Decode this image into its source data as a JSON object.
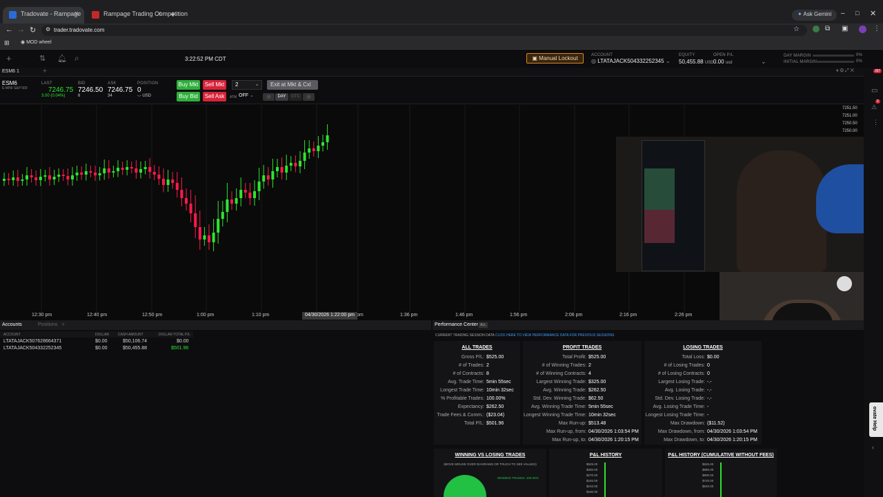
{
  "browser": {
    "tabs": [
      {
        "title": "Tradovate - Rampage",
        "active": true
      },
      {
        "title": "Rampage Trading Competition",
        "active": false
      }
    ],
    "url": "trader.tradovate.com",
    "ask_gemini": "Ask Gemini",
    "bookmark": "MOD wheel"
  },
  "header": {
    "time": "3:22:52 PM CDT",
    "lockout_button": "Manual Lockout",
    "account_label": "ACCOUNT",
    "account_value": "LTATAJACK504332252345",
    "equity_label": "EQUITY",
    "equity_value": "50,455.88",
    "equity_ccy": "USD",
    "openpl_label": "OPEN P/L",
    "openpl_value": "0.00",
    "openpl_ccy": "usd",
    "day_margin_label": "DAY MARGIN",
    "day_margin_pct": "0%",
    "initial_margin_label": "INITIAL MARGIN",
    "initial_margin_pct": "0%"
  },
  "symbol_bar": {
    "tab_label": "ESM6 1",
    "symbol": "ESM6",
    "desc": "E-MINI S&P 500",
    "last_label": "LAST",
    "last_value": "7246.75",
    "last_change": "3.00 (0.04%)",
    "bid_label": "BID",
    "bid_value": "7246.50",
    "bid_size": "6",
    "ask_label": "ASK",
    "ask_value": "7246.75",
    "ask_size": "34",
    "position_label": "POSITION",
    "position_value": "0",
    "position_ccy": "-,- USD"
  },
  "order": {
    "buy_mkt": "Buy Mkt",
    "sell_mkt": "Sell Mkt",
    "buy_bid": "Buy Bid",
    "sell_ask": "Sell Ask",
    "qty": "2",
    "exit": "Exit at Mkt & Cxl",
    "atm_label": "ATM",
    "atm_value": "OFF",
    "day": "DAY",
    "gtc": "GTC"
  },
  "chart_area": {
    "x_ticks": [
      "12:30 pm",
      "12:40 pm",
      "12:50 pm",
      "1:00 pm",
      "1:10 pm",
      "1:36 pm",
      "1:46 pm",
      "1:56 pm",
      "2:06 pm",
      "2:16 pm",
      "2:26 pm"
    ],
    "cursor_label": "04/30/2026 1:22:00 pm",
    "cursor_suffix": "pm",
    "y_ticks": [
      "7251.50",
      "7251.00",
      "7250.50",
      "7250.00"
    ]
  },
  "accounts_panel": {
    "tab_accounts": "Accounts",
    "tab_positions": "Positions",
    "col_account": "ACCOUNT",
    "col_dollar": "DOLLAR",
    "col_cash": "CASH AMOUNT",
    "col_total": "DOLLAR TOTAL P/L",
    "rows": [
      {
        "account": "LTATAJACK507628664371",
        "dollar": "$0.00",
        "cash": "$50,106.74",
        "total": "$0.00"
      },
      {
        "account": "LTATAJACK504332252345",
        "dollar": "$0.00",
        "cash": "$50,455.88",
        "total": "$501.96"
      }
    ]
  },
  "performance": {
    "title": "Performance Center",
    "all_badge": "ALL",
    "session_note": "CURRENT TRADING SESSION DATA",
    "session_link": "CLICK HERE TO VIEW PERFORMANCE DATA FOR PREVIOUS SESSIONS",
    "all_trades": {
      "header": "ALL TRADES",
      "rows": [
        {
          "k": "Gross P/L",
          "v": "$525.00"
        },
        {
          "k": "# of Trades",
          "v": "2"
        },
        {
          "k": "# of Contracts",
          "v": "8"
        },
        {
          "k": "Avg. Trade Time",
          "v": "5min 55sec"
        },
        {
          "k": "Longest Trade Time",
          "v": "10min 32sec"
        },
        {
          "k": "% Profitable Trades",
          "v": "100.00%"
        },
        {
          "k": "Expectancy",
          "v": "$262.50"
        },
        {
          "k": "Trade Fees & Comm.",
          "v": "($23.04)"
        },
        {
          "k": "Total P/L",
          "v": "$501.96"
        }
      ]
    },
    "profit_trades": {
      "header": "PROFIT TRADES",
      "rows": [
        {
          "k": "Total Profit",
          "v": "$525.00"
        },
        {
          "k": "# of Winning Trades",
          "v": "2"
        },
        {
          "k": "# of Winning Contracts",
          "v": "4"
        },
        {
          "k": "Largest Winning Trade",
          "v": "$325.00"
        },
        {
          "k": "Avg. Winning Trade",
          "v": "$262.50"
        },
        {
          "k": "Std. Dev. Winning Trade",
          "v": "$62.50"
        },
        {
          "k": "Avg. Winning Trade Time",
          "v": "5min 55sec"
        },
        {
          "k": "Longest Winning Trade Time",
          "v": "10min 32sec"
        },
        {
          "k": "Max Run-up",
          "v": "$513.48"
        },
        {
          "k": "Max Run-up, from",
          "v": "04/30/2026 1:03:54 PM"
        },
        {
          "k": "Max Run-up, to",
          "v": "04/30/2026 1:20:15 PM"
        }
      ]
    },
    "losing_trades": {
      "header": "LOSING TRADES",
      "rows": [
        {
          "k": "Total Loss",
          "v": "$0.00"
        },
        {
          "k": "# of Losing Trades",
          "v": "0"
        },
        {
          "k": "# of Losing Contracts",
          "v": "0"
        },
        {
          "k": "Largest Losing Trade",
          "v": "-.-"
        },
        {
          "k": "Avg. Losing Trade",
          "v": "-.-"
        },
        {
          "k": "Std. Dev. Losing Trade",
          "v": "-.-"
        },
        {
          "k": "Avg. Losing Trade Time",
          "v": "-"
        },
        {
          "k": "Longest Losing Trade Time",
          "v": "-"
        },
        {
          "k": "Max Drawdown",
          "v": "($11.52)"
        },
        {
          "k": "Max Drawdown, from",
          "v": "04/30/2026 1:03:54 PM"
        },
        {
          "k": "Max Drawdown, to",
          "v": "04/30/2026 1:20:15 PM"
        }
      ]
    },
    "chart_titles": {
      "win_vs_lose": "WINNING VS LOSING TRADES",
      "win_vs_lose_note": "(MOVE MOUSE OVER DIAGRAMS OR TOUCH TO SEE VALUES)",
      "winning_label": "WINNING TRADES: 100.00%",
      "pl_history": "P&L HISTORY",
      "pl_history_cum": "P&L HISTORY (CUMULATIVE WITHOUT FEES)",
      "pl_ticks": [
        "$525.00",
        "$300.00",
        "$270.00",
        "$240.00",
        "$210.00",
        "$180.00"
      ],
      "cum_ticks": [
        "$525.00",
        "$880.00",
        "$800.00",
        "$720.00",
        "$640.00"
      ]
    }
  },
  "side": {
    "badge1": "367",
    "badge2": "2",
    "help": "ovate Help"
  },
  "colors": {
    "up": "#2ee52e",
    "down": "#ff1a4b",
    "buy": "#2fae3b",
    "sell": "#d8233a",
    "link": "#3aa0ff",
    "lockout_border": "#d88a20"
  }
}
